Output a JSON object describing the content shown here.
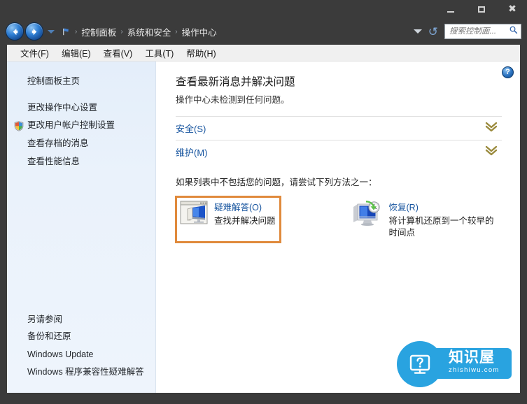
{
  "window": {
    "controls": {
      "minimize_label": "最小化",
      "maximize_label": "最大化",
      "close_label": "关闭"
    }
  },
  "addressbar": {
    "back_label": "后退",
    "forward_label": "前进",
    "recent_dropdown_label": "最近浏览的页面",
    "breadcrumbs": [
      "控制面板",
      "系统和安全",
      "操作中心"
    ],
    "separator": "›",
    "refresh_label": "刷新",
    "previous_locations_label": "以前的位置"
  },
  "search": {
    "placeholder": "搜索控制面...",
    "value": "",
    "icon": "search-icon"
  },
  "menubar": {
    "items": [
      "文件(F)",
      "编辑(E)",
      "查看(V)",
      "工具(T)",
      "帮助(H)"
    ]
  },
  "sidebar": {
    "home": "控制面板主页",
    "items": [
      {
        "label": "更改操作中心设置",
        "icon": null
      },
      {
        "label": "更改用户帐户控制设置",
        "icon": "shield-icon"
      },
      {
        "label": "查看存档的消息",
        "icon": null
      },
      {
        "label": "查看性能信息",
        "icon": null
      }
    ],
    "see_also_heading": "另请参阅",
    "see_also_items": [
      "备份和还原",
      "Windows Update",
      "Windows 程序兼容性疑难解答"
    ]
  },
  "main": {
    "help_label": "帮助",
    "title": "查看最新消息并解决问题",
    "subtitle": "操作中心未检测到任何问题。",
    "sections": [
      {
        "label": "安全(S)",
        "expander": "chevron-double-down-icon",
        "expanded": false
      },
      {
        "label": "维护(M)",
        "expander": "chevron-double-down-icon",
        "expanded": false
      }
    ],
    "hint": "如果列表中不包括您的问题，请尝试下列方法之一：",
    "actions": [
      {
        "title": "疑难解答(O)",
        "desc": "查找并解决问题",
        "icon": "troubleshoot-monitor-icon",
        "highlighted": true
      },
      {
        "title": "恢复(R)",
        "desc": "将计算机还原到一个较早的时间点",
        "icon": "recovery-monitor-clock-icon",
        "highlighted": false
      }
    ]
  },
  "watermark": {
    "cn": "知识屋",
    "en": "zhishiwu.com",
    "icon": "monitor-question-icon"
  },
  "colors": {
    "chrome": "#3b3b3b",
    "link": "#15539e",
    "sidebar_bg": "#eaf2fb",
    "highlight_border": "#e08a3c",
    "chevron": "#9a8a3c",
    "watermark_blue": "#29a3e0"
  }
}
